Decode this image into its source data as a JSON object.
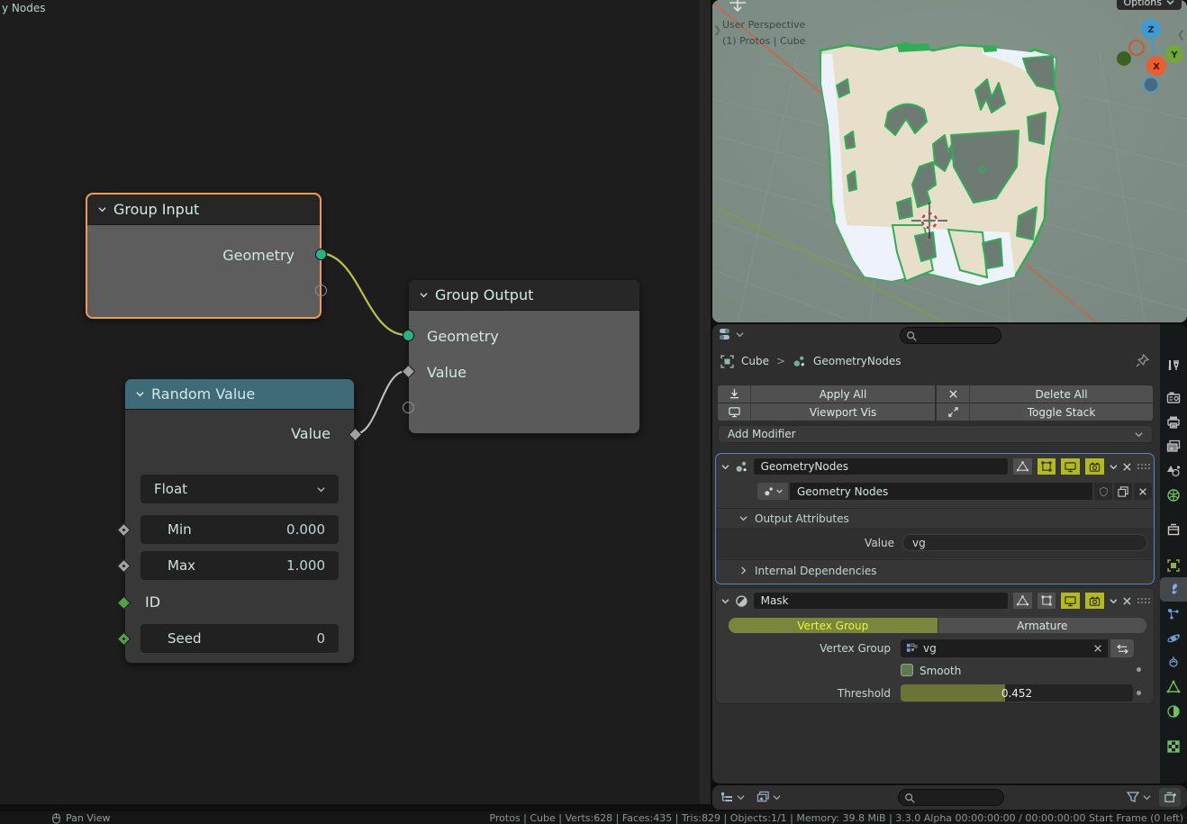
{
  "colors": {
    "selected_node_border": "#ee9a4a",
    "converter_node_header": "#3e6b77",
    "socket_geometry": "#28b384",
    "socket_float": "#a1a1a1",
    "socket_int": "#55a044",
    "active_modifier_border": "#5a82c2",
    "toggle_on_yellow": "#b4ba1e",
    "enum_active_olive": "#78873b",
    "viewport_background": "#7e8d85",
    "axis_x": "#e4592d",
    "axis_y": "#6fae3a",
    "axis_z": "#3f9bd0"
  },
  "node_editor": {
    "breadcrumb": "y Nodes",
    "group_input": {
      "title": "Group Input",
      "output": "Geometry"
    },
    "group_output": {
      "title": "Group Output",
      "input_geometry": "Geometry",
      "input_value": "Value"
    },
    "random_value": {
      "title": "Random Value",
      "output": "Value",
      "type": "Float",
      "min_label": "Min",
      "min_value": "0.000",
      "max_label": "Max",
      "max_value": "1.000",
      "id_label": "ID",
      "seed_label": "Seed",
      "seed_value": "0"
    }
  },
  "viewport": {
    "projection": "User Perspective",
    "scene_info": "(1) Protos | Cube",
    "options": "Options",
    "axis_x": "X",
    "axis_y": "Y",
    "axis_z": "Z"
  },
  "properties": {
    "breadcrumb_object": "Cube",
    "breadcrumb_sep": ">",
    "breadcrumb_tree": "GeometryNodes",
    "apply_all": "Apply All",
    "delete_all": "Delete All",
    "viewport_vis": "Viewport Vis",
    "toggle_stack": "Toggle Stack",
    "add_modifier": "Add Modifier",
    "gn": {
      "name": "GeometryNodes",
      "tree_name": "Geometry Nodes",
      "output_attributes": "Output Attributes",
      "value_label": "Value",
      "value": "vg",
      "internal_dependencies": "Internal Dependencies"
    },
    "mask": {
      "name": "Mask",
      "vertex_group_tab": "Vertex Group",
      "armature_tab": "Armature",
      "vertex_group_label": "Vertex Group",
      "vertex_group_value": "vg",
      "smooth": "Smooth",
      "threshold_label": "Threshold",
      "threshold_value": "0.452"
    },
    "tabs": [
      "tool",
      "render",
      "output",
      "view-layer",
      "scene",
      "world",
      "collection",
      "object",
      "modifiers",
      "particles",
      "physics",
      "constraints",
      "object-data",
      "material",
      "texture"
    ]
  },
  "status": {
    "left": "Pan View",
    "right": "Protos | Cube | Verts:628 | Faces:435 | Tris:829 | Objects:1/1 | Memory: 39.8 MiB | 3.3.0 Alpha  00:00:00:00 / 00:00:00:00  Start Frame (0 left)"
  }
}
